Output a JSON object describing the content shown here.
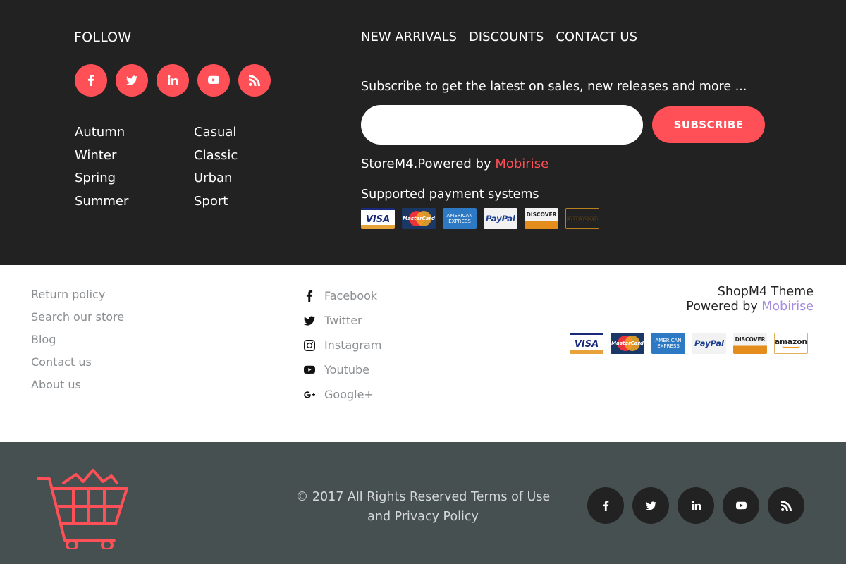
{
  "colors": {
    "accent": "#ff4f57",
    "dark_bg": "#232222",
    "bottom_bg": "#465050",
    "brand_link": "#a78bdf",
    "muted_text": "#8a8e91"
  },
  "follow": {
    "title": "FOLLOW",
    "social_icons": [
      "facebook-icon",
      "twitter-icon",
      "linkedin-icon",
      "youtube-icon",
      "rss-icon"
    ],
    "season_col1": [
      "Autumn",
      "Winter",
      "Spring",
      "Summer"
    ],
    "season_col2": [
      "Casual",
      "Classic",
      "Urban",
      "Sport"
    ]
  },
  "topnav": [
    "NEW ARRIVALS",
    "DISCOUNTS",
    "CONTACT US"
  ],
  "subscribe": {
    "text": "Subscribe to get the latest on sales, new releases and more ...",
    "input_placeholder": "",
    "button_label": "SUBSCRIBE"
  },
  "powered_top": {
    "prefix": "StoreM4.Powered by ",
    "brand": "Mobirise"
  },
  "payment": {
    "title": "Supported payment systems",
    "cards": [
      "VISA",
      "MasterCard",
      "AMERICAN EXPRESS",
      "PayPal",
      "DISCOVER",
      "amazon"
    ]
  },
  "links": [
    "Return policy",
    "Search our store",
    "Blog",
    "Contact us",
    "About us"
  ],
  "social_links": [
    {
      "icon": "facebook-icon",
      "label": "Facebook"
    },
    {
      "icon": "twitter-icon",
      "label": "Twitter"
    },
    {
      "icon": "instagram-icon",
      "label": "Instagram"
    },
    {
      "icon": "youtube-icon",
      "label": "Youtube"
    },
    {
      "icon": "google-plus-icon",
      "label": "Google+"
    }
  ],
  "theme": {
    "name": "ShopM4 Theme",
    "powered_prefix": "Powered by ",
    "brand": "Mobirise"
  },
  "bottom": {
    "copyright_line1": "© 2017 All Rights Reserved Terms of Use",
    "copyright_line2": "and Privacy Policy",
    "social_icons": [
      "facebook-icon",
      "twitter-icon",
      "linkedin-icon",
      "youtube-icon",
      "rss-icon"
    ]
  }
}
